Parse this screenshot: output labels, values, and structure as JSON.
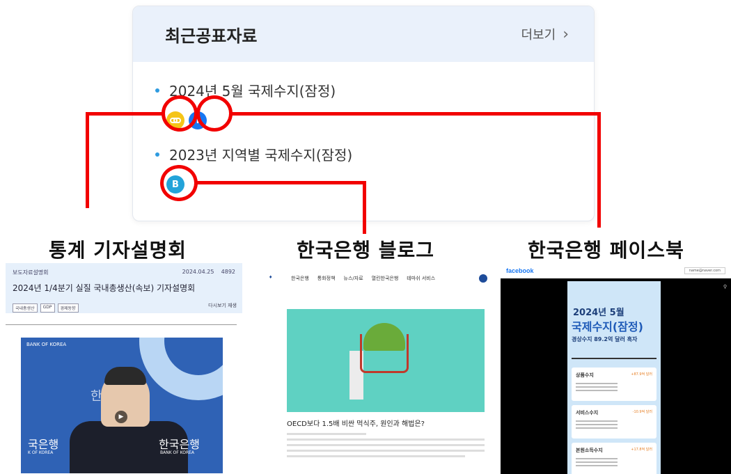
{
  "card": {
    "title": "최근공표자료",
    "more_label": "더보기",
    "items": [
      {
        "title": "2024년 5월 국제수지(잠정)",
        "icons": [
          "link-icon",
          "facebook-icon"
        ]
      },
      {
        "title": "2023년 지역별 국제수지(잠정)",
        "icons": [
          "blog-icon"
        ]
      }
    ]
  },
  "icons": {
    "facebook_glyph": "f",
    "blog_glyph": "B",
    "link_glyph": "⊖"
  },
  "labels": {
    "briefing": "통계 기자설명회",
    "blog": "한국은행 블로그",
    "facebook": "한국은행 페이스북"
  },
  "thumbnails": {
    "briefing": {
      "category": "보도자료설명회",
      "date": "2024.04.25",
      "views": "4892",
      "title": "2024년 1/4분기 실질 국내총생산(속보) 기자설명회",
      "tags": [
        "국내총생산",
        "GDP",
        "경제동향"
      ],
      "replay": "다시보기 재생",
      "video_logo_top": "BANK OF KOREA",
      "video_logo_left": "국은행",
      "video_logo_left_sub": "K OF KOREA",
      "video_logo_right": "한국은행",
      "video_logo_right_sub": "BANK OF KOREA",
      "video_bg_text": "한"
    },
    "blog": {
      "nav": [
        "한국은행",
        "통화정책",
        "뉴스/자료",
        "열린한국은행",
        "테마쉬 서비스"
      ],
      "headline": "OECD보다 1.5배 비싼 먹식주, 원인과 해법은?"
    },
    "facebook": {
      "brand": "facebook",
      "email": "name@naver.com",
      "poster_month": "2024년 5월",
      "poster_title": "국제수지(잠정)",
      "poster_sub": "경상수지 89.2억 달러 흑자",
      "panels": [
        {
          "title": "상품수지",
          "badge": "+87.9억 달러"
        },
        {
          "title": "서비스수지",
          "badge": "-10.9억 달러"
        },
        {
          "title": "본원소득수지",
          "badge": "+17.8억 달러"
        }
      ]
    }
  },
  "colors": {
    "annotation": "#f20000",
    "card_header": "#eaf1fb",
    "bullet": "#2e9be0"
  }
}
